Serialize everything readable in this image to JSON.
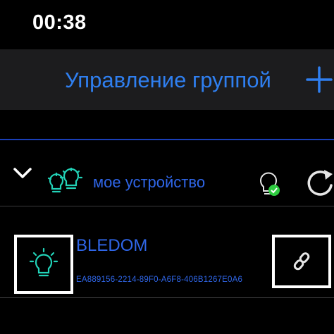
{
  "status_bar": {
    "time": "00:38"
  },
  "nav": {
    "title": "Управление группой",
    "add_icon": "plus-icon",
    "accent_color": "#2f7ff0"
  },
  "group": {
    "name": "мое устройство",
    "expand_icon": "chevron-down-icon",
    "icon": "bulbs-group-icon",
    "status_icon": "bulb-connected-icon",
    "refresh_icon": "refresh-icon",
    "icon_color": "#22d3b8"
  },
  "device": {
    "name": "BLEDOM",
    "uuid": "EA889156-2214-89F0-A6F8-406B1267E0A6",
    "icon": "bulb-icon",
    "link_icon": "link-icon"
  }
}
